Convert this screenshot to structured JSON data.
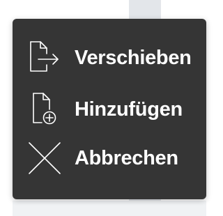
{
  "menu": {
    "items": [
      {
        "label": "Verschieben",
        "icon": "file-move-icon"
      },
      {
        "label": "Hinzufügen",
        "icon": "file-add-icon"
      },
      {
        "label": "Abbrechen",
        "icon": "close-icon"
      }
    ],
    "colors": {
      "background": "#353535",
      "text": "#ffffff",
      "icon_stroke": "#ffffff"
    }
  }
}
